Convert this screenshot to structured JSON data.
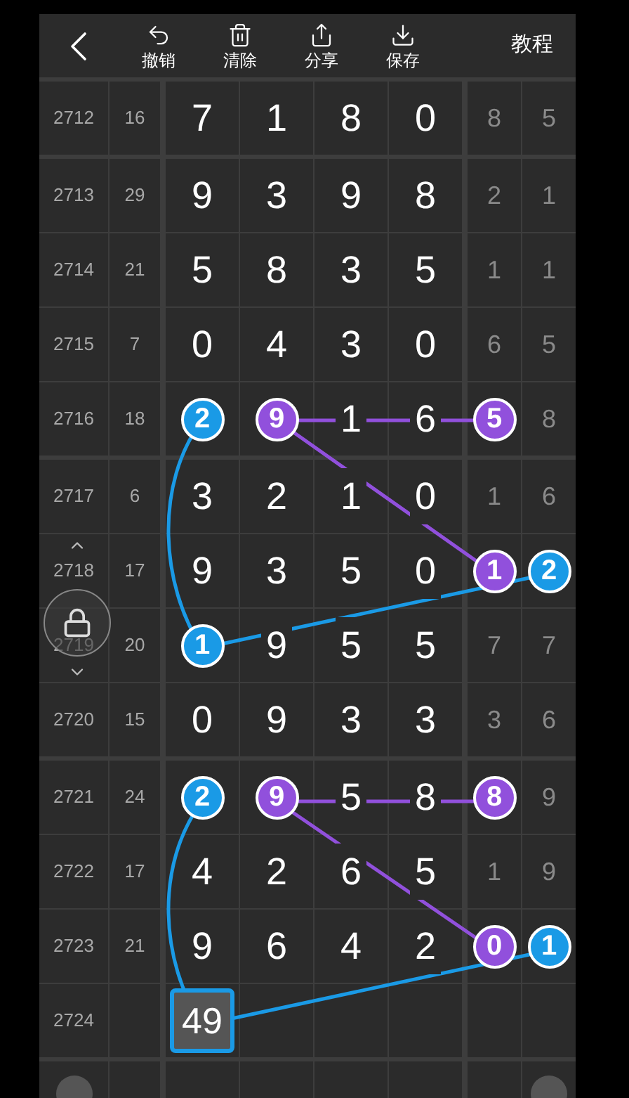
{
  "toolbar": {
    "items": [
      {
        "label": "撤销"
      },
      {
        "label": "清除"
      },
      {
        "label": "分享"
      },
      {
        "label": "保存"
      }
    ],
    "tutorial": "教程"
  },
  "groups": [
    {
      "rows": [
        {
          "kind": "result",
          "issue": "2712",
          "sum": "16",
          "digits": [
            {
              "value": "7"
            },
            {
              "value": "1"
            },
            {
              "value": "8"
            },
            {
              "value": "0"
            }
          ],
          "tail": [
            {
              "value": "8"
            },
            {
              "value": "5"
            }
          ]
        }
      ]
    },
    {
      "rows": [
        {
          "kind": "result",
          "issue": "2713",
          "sum": "29",
          "digits": [
            {
              "value": "9"
            },
            {
              "value": "3"
            },
            {
              "value": "9"
            },
            {
              "value": "8"
            }
          ],
          "tail": [
            {
              "value": "2"
            },
            {
              "value": "1"
            }
          ]
        },
        {
          "kind": "result",
          "issue": "2714",
          "sum": "21",
          "digits": [
            {
              "value": "5"
            },
            {
              "value": "8"
            },
            {
              "value": "3"
            },
            {
              "value": "5"
            }
          ],
          "tail": [
            {
              "value": "1"
            },
            {
              "value": "1"
            }
          ]
        },
        {
          "kind": "result",
          "issue": "2715",
          "sum": "7",
          "digits": [
            {
              "value": "0"
            },
            {
              "value": "4"
            },
            {
              "value": "3"
            },
            {
              "value": "0"
            }
          ],
          "tail": [
            {
              "value": "6"
            },
            {
              "value": "5"
            }
          ]
        },
        {
          "kind": "result",
          "issue": "2716",
          "sum": "18",
          "digits": [
            {
              "value": "2",
              "color": "#1a9ae6"
            },
            {
              "value": "9",
              "color": "#9150dc"
            },
            {
              "value": "1"
            },
            {
              "value": "6"
            }
          ],
          "tail": [
            {
              "value": "5",
              "color": "#9150dc"
            },
            {
              "value": "8"
            }
          ]
        }
      ]
    },
    {
      "rows": [
        {
          "kind": "result",
          "issue": "2717",
          "sum": "6",
          "digits": [
            {
              "value": "3"
            },
            {
              "value": "2"
            },
            {
              "value": "1"
            },
            {
              "value": "0"
            }
          ],
          "tail": [
            {
              "value": "1"
            },
            {
              "value": "6"
            }
          ]
        },
        {
          "kind": "result",
          "issue": "2718",
          "sum": "17",
          "digits": [
            {
              "value": "9"
            },
            {
              "value": "3"
            },
            {
              "value": "5"
            },
            {
              "value": "0"
            }
          ],
          "tail": [
            {
              "value": "1",
              "color": "#9150dc"
            },
            {
              "value": "2",
              "color": "#1a9ae6"
            }
          ]
        },
        {
          "kind": "result",
          "issue": "2719",
          "sum": "20",
          "digits": [
            {
              "value": "1",
              "color": "#1a9ae6"
            },
            {
              "value": "9"
            },
            {
              "value": "5"
            },
            {
              "value": "5"
            }
          ],
          "tail": [
            {
              "value": "7"
            },
            {
              "value": "7"
            }
          ]
        },
        {
          "kind": "result",
          "issue": "2720",
          "sum": "15",
          "digits": [
            {
              "value": "0"
            },
            {
              "value": "9"
            },
            {
              "value": "3"
            },
            {
              "value": "3"
            }
          ],
          "tail": [
            {
              "value": "3"
            },
            {
              "value": "6"
            }
          ]
        }
      ]
    },
    {
      "rows": [
        {
          "kind": "result",
          "issue": "2721",
          "sum": "24",
          "digits": [
            {
              "value": "2",
              "color": "#1a9ae6"
            },
            {
              "value": "9",
              "color": "#9150dc"
            },
            {
              "value": "5"
            },
            {
              "value": "8"
            }
          ],
          "tail": [
            {
              "value": "8",
              "color": "#9150dc"
            },
            {
              "value": "9"
            }
          ]
        },
        {
          "kind": "result",
          "issue": "2722",
          "sum": "17",
          "digits": [
            {
              "value": "4"
            },
            {
              "value": "2"
            },
            {
              "value": "6"
            },
            {
              "value": "5"
            }
          ],
          "tail": [
            {
              "value": "1"
            },
            {
              "value": "9"
            }
          ]
        },
        {
          "kind": "result",
          "issue": "2723",
          "sum": "21",
          "digits": [
            {
              "value": "9"
            },
            {
              "value": "6"
            },
            {
              "value": "4"
            },
            {
              "value": "2"
            }
          ],
          "tail": [
            {
              "value": "0",
              "color": "#9150dc"
            },
            {
              "value": "1",
              "color": "#1a9ae6"
            }
          ]
        },
        {
          "kind": "forecast",
          "issue": "2724",
          "digits": [
            {
              "value": "49",
              "color": "#1a9ae6"
            }
          ]
        }
      ]
    }
  ]
}
